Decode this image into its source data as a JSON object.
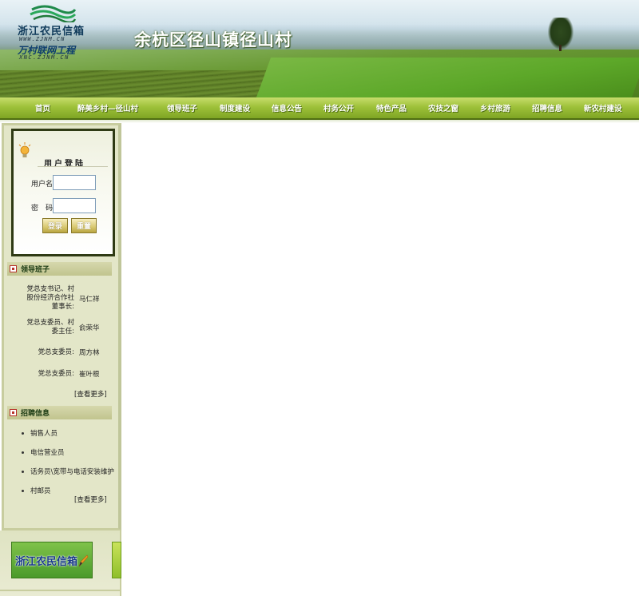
{
  "header": {
    "logo_brand": "浙江农民信箱",
    "logo_url1": "WWW.ZJNM.CN",
    "logo_brand2": "万村联网工程",
    "logo_url2": "XNC.ZJNM.CN",
    "village_title": "余杭区径山镇径山村"
  },
  "nav": {
    "items": [
      {
        "label": "首页"
      },
      {
        "label": "醉美乡村—径山村"
      },
      {
        "label": "领导班子"
      },
      {
        "label": "制度建设"
      },
      {
        "label": "信息公告"
      },
      {
        "label": "村务公开"
      },
      {
        "label": "特色产品"
      },
      {
        "label": "农技之窗"
      },
      {
        "label": "乡村旅游"
      },
      {
        "label": "招聘信息"
      },
      {
        "label": "新农村建设"
      }
    ]
  },
  "login": {
    "title": "用户登陆",
    "username_label": "用户名:",
    "password_label": "密　码:",
    "username_value": "",
    "password_value": "",
    "login_button": "登录",
    "reset_button": "重置"
  },
  "leaders": {
    "heading": "领导班子",
    "rows": [
      {
        "role": "党总支书记、村股份经济合作社董事长:",
        "name": "马仁祥"
      },
      {
        "role": "党总支委员、村委主任:",
        "name": "俞荣华"
      },
      {
        "role": "党总支委员:",
        "name": "周方林"
      },
      {
        "role": "党总支委员:",
        "name": "崔叶根"
      }
    ],
    "more": "[查看更多]"
  },
  "jobs": {
    "heading": "招聘信息",
    "items": [
      {
        "label": "销售人员"
      },
      {
        "label": "电信营业员"
      },
      {
        "label": "话务员\\宽带与电话安装维护"
      },
      {
        "label": "村邮员"
      }
    ],
    "more": "[查看更多]"
  },
  "mailbox": {
    "label": "浙江农民信箱"
  },
  "colors": {
    "nav_green": "#9ec13a",
    "sidebar_bg": "#e3e6c8",
    "section_head": "#c1c48e",
    "login_frame": "#2f3a14",
    "accent_red": "#b7322a"
  },
  "icons": {
    "logo": "wave-logo-icon",
    "login": "lightbulb-icon",
    "section": "red-square-bullet-icon",
    "mailbox": "pen-icon"
  }
}
